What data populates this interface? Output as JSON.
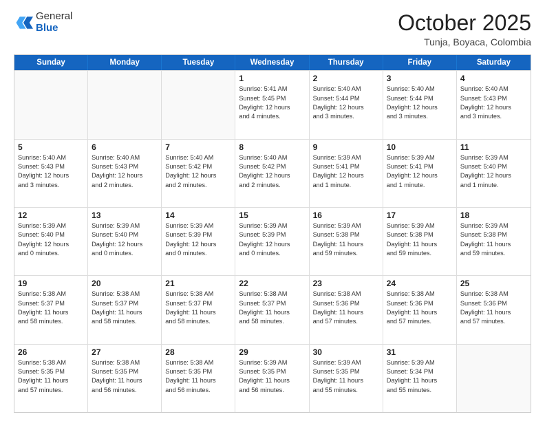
{
  "header": {
    "logo_general": "General",
    "logo_blue": "Blue",
    "month": "October 2025",
    "location": "Tunja, Boyaca, Colombia"
  },
  "weekdays": [
    "Sunday",
    "Monday",
    "Tuesday",
    "Wednesday",
    "Thursday",
    "Friday",
    "Saturday"
  ],
  "rows": [
    [
      {
        "day": "",
        "empty": true,
        "lines": []
      },
      {
        "day": "",
        "empty": true,
        "lines": []
      },
      {
        "day": "",
        "empty": true,
        "lines": []
      },
      {
        "day": "1",
        "empty": false,
        "lines": [
          "Sunrise: 5:41 AM",
          "Sunset: 5:45 PM",
          "Daylight: 12 hours",
          "and 4 minutes."
        ]
      },
      {
        "day": "2",
        "empty": false,
        "lines": [
          "Sunrise: 5:40 AM",
          "Sunset: 5:44 PM",
          "Daylight: 12 hours",
          "and 3 minutes."
        ]
      },
      {
        "day": "3",
        "empty": false,
        "lines": [
          "Sunrise: 5:40 AM",
          "Sunset: 5:44 PM",
          "Daylight: 12 hours",
          "and 3 minutes."
        ]
      },
      {
        "day": "4",
        "empty": false,
        "lines": [
          "Sunrise: 5:40 AM",
          "Sunset: 5:43 PM",
          "Daylight: 12 hours",
          "and 3 minutes."
        ]
      }
    ],
    [
      {
        "day": "5",
        "empty": false,
        "lines": [
          "Sunrise: 5:40 AM",
          "Sunset: 5:43 PM",
          "Daylight: 12 hours",
          "and 3 minutes."
        ]
      },
      {
        "day": "6",
        "empty": false,
        "lines": [
          "Sunrise: 5:40 AM",
          "Sunset: 5:43 PM",
          "Daylight: 12 hours",
          "and 2 minutes."
        ]
      },
      {
        "day": "7",
        "empty": false,
        "lines": [
          "Sunrise: 5:40 AM",
          "Sunset: 5:42 PM",
          "Daylight: 12 hours",
          "and 2 minutes."
        ]
      },
      {
        "day": "8",
        "empty": false,
        "lines": [
          "Sunrise: 5:40 AM",
          "Sunset: 5:42 PM",
          "Daylight: 12 hours",
          "and 2 minutes."
        ]
      },
      {
        "day": "9",
        "empty": false,
        "lines": [
          "Sunrise: 5:39 AM",
          "Sunset: 5:41 PM",
          "Daylight: 12 hours",
          "and 1 minute."
        ]
      },
      {
        "day": "10",
        "empty": false,
        "lines": [
          "Sunrise: 5:39 AM",
          "Sunset: 5:41 PM",
          "Daylight: 12 hours",
          "and 1 minute."
        ]
      },
      {
        "day": "11",
        "empty": false,
        "lines": [
          "Sunrise: 5:39 AM",
          "Sunset: 5:40 PM",
          "Daylight: 12 hours",
          "and 1 minute."
        ]
      }
    ],
    [
      {
        "day": "12",
        "empty": false,
        "lines": [
          "Sunrise: 5:39 AM",
          "Sunset: 5:40 PM",
          "Daylight: 12 hours",
          "and 0 minutes."
        ]
      },
      {
        "day": "13",
        "empty": false,
        "lines": [
          "Sunrise: 5:39 AM",
          "Sunset: 5:40 PM",
          "Daylight: 12 hours",
          "and 0 minutes."
        ]
      },
      {
        "day": "14",
        "empty": false,
        "lines": [
          "Sunrise: 5:39 AM",
          "Sunset: 5:39 PM",
          "Daylight: 12 hours",
          "and 0 minutes."
        ]
      },
      {
        "day": "15",
        "empty": false,
        "lines": [
          "Sunrise: 5:39 AM",
          "Sunset: 5:39 PM",
          "Daylight: 12 hours",
          "and 0 minutes."
        ]
      },
      {
        "day": "16",
        "empty": false,
        "lines": [
          "Sunrise: 5:39 AM",
          "Sunset: 5:38 PM",
          "Daylight: 11 hours",
          "and 59 minutes."
        ]
      },
      {
        "day": "17",
        "empty": false,
        "lines": [
          "Sunrise: 5:39 AM",
          "Sunset: 5:38 PM",
          "Daylight: 11 hours",
          "and 59 minutes."
        ]
      },
      {
        "day": "18",
        "empty": false,
        "lines": [
          "Sunrise: 5:39 AM",
          "Sunset: 5:38 PM",
          "Daylight: 11 hours",
          "and 59 minutes."
        ]
      }
    ],
    [
      {
        "day": "19",
        "empty": false,
        "lines": [
          "Sunrise: 5:38 AM",
          "Sunset: 5:37 PM",
          "Daylight: 11 hours",
          "and 58 minutes."
        ]
      },
      {
        "day": "20",
        "empty": false,
        "lines": [
          "Sunrise: 5:38 AM",
          "Sunset: 5:37 PM",
          "Daylight: 11 hours",
          "and 58 minutes."
        ]
      },
      {
        "day": "21",
        "empty": false,
        "lines": [
          "Sunrise: 5:38 AM",
          "Sunset: 5:37 PM",
          "Daylight: 11 hours",
          "and 58 minutes."
        ]
      },
      {
        "day": "22",
        "empty": false,
        "lines": [
          "Sunrise: 5:38 AM",
          "Sunset: 5:37 PM",
          "Daylight: 11 hours",
          "and 58 minutes."
        ]
      },
      {
        "day": "23",
        "empty": false,
        "lines": [
          "Sunrise: 5:38 AM",
          "Sunset: 5:36 PM",
          "Daylight: 11 hours",
          "and 57 minutes."
        ]
      },
      {
        "day": "24",
        "empty": false,
        "lines": [
          "Sunrise: 5:38 AM",
          "Sunset: 5:36 PM",
          "Daylight: 11 hours",
          "and 57 minutes."
        ]
      },
      {
        "day": "25",
        "empty": false,
        "lines": [
          "Sunrise: 5:38 AM",
          "Sunset: 5:36 PM",
          "Daylight: 11 hours",
          "and 57 minutes."
        ]
      }
    ],
    [
      {
        "day": "26",
        "empty": false,
        "lines": [
          "Sunrise: 5:38 AM",
          "Sunset: 5:35 PM",
          "Daylight: 11 hours",
          "and 57 minutes."
        ]
      },
      {
        "day": "27",
        "empty": false,
        "lines": [
          "Sunrise: 5:38 AM",
          "Sunset: 5:35 PM",
          "Daylight: 11 hours",
          "and 56 minutes."
        ]
      },
      {
        "day": "28",
        "empty": false,
        "lines": [
          "Sunrise: 5:38 AM",
          "Sunset: 5:35 PM",
          "Daylight: 11 hours",
          "and 56 minutes."
        ]
      },
      {
        "day": "29",
        "empty": false,
        "lines": [
          "Sunrise: 5:39 AM",
          "Sunset: 5:35 PM",
          "Daylight: 11 hours",
          "and 56 minutes."
        ]
      },
      {
        "day": "30",
        "empty": false,
        "lines": [
          "Sunrise: 5:39 AM",
          "Sunset: 5:35 PM",
          "Daylight: 11 hours",
          "and 55 minutes."
        ]
      },
      {
        "day": "31",
        "empty": false,
        "lines": [
          "Sunrise: 5:39 AM",
          "Sunset: 5:34 PM",
          "Daylight: 11 hours",
          "and 55 minutes."
        ]
      },
      {
        "day": "",
        "empty": true,
        "lines": []
      }
    ]
  ]
}
